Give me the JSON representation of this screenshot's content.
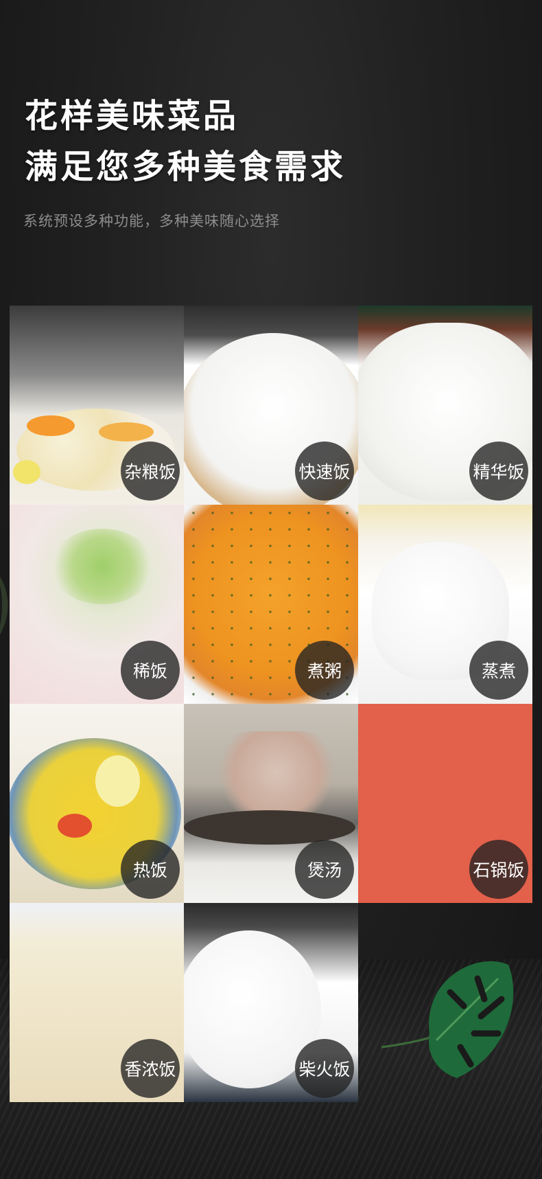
{
  "header": {
    "title_line1": "花样美味菜品",
    "title_line2": "满足您多种美食需求",
    "subtitle": "系统预设多种功能，多种美味随心选择"
  },
  "menu": {
    "items": [
      {
        "label": "杂粮饭"
      },
      {
        "label": "快速饭"
      },
      {
        "label": "精华饭"
      },
      {
        "label": "稀饭"
      },
      {
        "label": "煮粥"
      },
      {
        "label": "蒸煮"
      },
      {
        "label": "热饭"
      },
      {
        "label": "煲汤"
      },
      {
        "label": "石锅饭"
      },
      {
        "label": "香浓饭"
      },
      {
        "label": "柴火饭"
      }
    ]
  },
  "colors": {
    "background": "#1d1d1d",
    "title": "#ffffff",
    "subtitle": "#8d8d8d",
    "accent_tile": "#e3604a",
    "badge": "#232323"
  }
}
